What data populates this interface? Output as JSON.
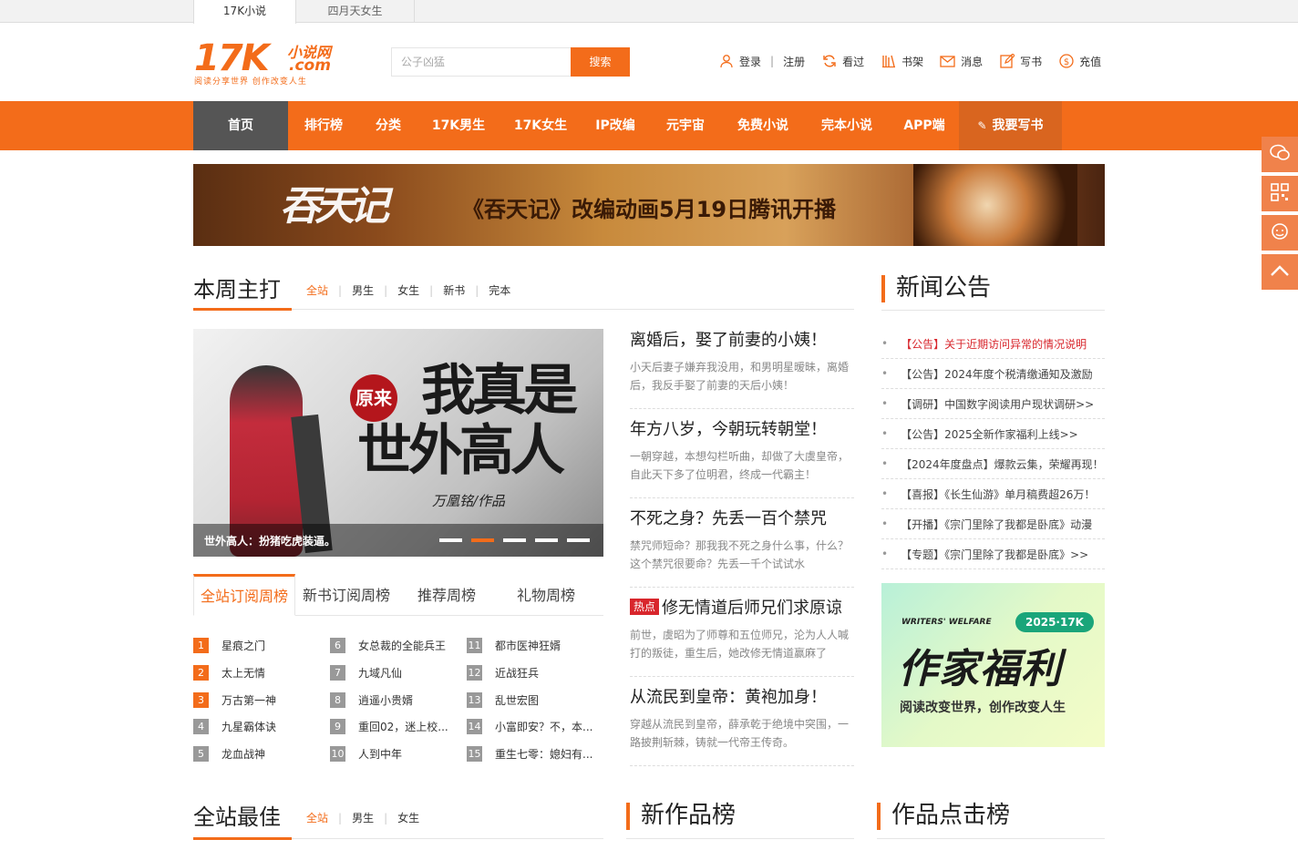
{
  "site_tabs": [
    "17K小说",
    "四月天女生"
  ],
  "logo": {
    "main": "17K",
    "sub1": "小说网",
    "sub2": ".com",
    "slogan": "阅读分享世界  创作改变人生"
  },
  "search": {
    "placeholder": "公子凶猛",
    "button": "搜索"
  },
  "user_links": {
    "login": "登录",
    "sep": "|",
    "register": "注册",
    "history": "看过",
    "bookshelf": "书架",
    "messages": "消息",
    "write": "写书",
    "recharge": "充值"
  },
  "nav": [
    "首页",
    "排行榜",
    "分类",
    "17K男生",
    "17K女生",
    "IP改编",
    "元宇宙",
    "免费小说",
    "完本小说",
    "APP端",
    "我要写书"
  ],
  "banner": {
    "calligraphy": "吞天记",
    "text": "《吞天记》改编动画5月19日腾讯开播"
  },
  "weekly": {
    "title": "本周主打",
    "tabs": [
      "全站",
      "男生",
      "女生",
      "新书",
      "完本"
    ],
    "slide": {
      "badge": "原来",
      "line1": "我真是",
      "line2": "世外高人",
      "author": "万凰铭/作品",
      "caption": "世外高人：扮猪吃虎装逼。"
    }
  },
  "rank_tabs": [
    "全站订阅周榜",
    "新书订阅周榜",
    "推荐周榜",
    "礼物周榜"
  ],
  "rank": [
    [
      "星痕之门",
      "太上无情",
      "万古第一神",
      "九星霸体诀",
      "龙血战神"
    ],
    [
      "女总裁的全能兵王",
      "九域凡仙",
      "逍遥小贵婿",
      "重回02，迷上校...",
      "人到中年"
    ],
    [
      "都市医神狂婿",
      "近战狂兵",
      "乱世宏图",
      "小富即安？不，本...",
      "重生七零：媳妇有..."
    ]
  ],
  "articles": [
    {
      "title": "离婚后，娶了前妻的小姨！",
      "desc": "小天后妻子嫌弃我没用，和男明星暧昧，离婚后，我反手娶了前妻的天后小姨！"
    },
    {
      "title": "年方八岁，今朝玩转朝堂！",
      "desc": "一朝穿越，本想勾栏听曲，却做了大虞皇帝，自此天下多了位明君，终成一代霸主！"
    },
    {
      "title": "不死之身？先丢一百个禁咒",
      "desc": "禁咒师短命？那我我不死之身什么事，什么？这个禁咒很要命？先丢一千个试试水"
    },
    {
      "badge": "热点",
      "title": "修无情道后师兄们求原谅",
      "desc": "前世，虞昭为了师尊和五位师兄，沦为人人喊打的叛徒，重生后，她改修无情道赢麻了"
    },
    {
      "title": "从流民到皇帝：黄袍加身！",
      "desc": "穿越从流民到皇帝，薛承乾于绝境中突围，一路披荆斩棘，铸就一代帝王传奇。"
    }
  ],
  "news": {
    "title": "新闻公告",
    "items": [
      "【公告】关于近期访问异常的情况说明",
      "【公告】2024年度个税清缴通知及激励",
      "【调研】中国数字阅读用户现状调研>>",
      "【公告】2025全新作家福利上线>>",
      "【2024年度盘点】爆款云集，荣耀再现！",
      "【喜报】《长生仙游》单月稿费超26万！",
      "【开播】《宗门里除了我都是卧底》动漫",
      "【专题】《宗门里除了我都是卧底》>>"
    ]
  },
  "promo": {
    "ww": "WRITERS' WELFARE",
    "year": "2025·17K",
    "title": "作家福利",
    "sub": "阅读改变世界，创作改变人生"
  },
  "best": {
    "title": "全站最佳",
    "tabs": [
      "全站",
      "男生",
      "女生"
    ]
  },
  "new_rank": {
    "title": "新作品榜"
  },
  "click_rank": {
    "title": "作品点击榜"
  },
  "colors": {
    "accent": "#f36c1a",
    "nav_home": "#555555",
    "hot": "#d8262c"
  }
}
